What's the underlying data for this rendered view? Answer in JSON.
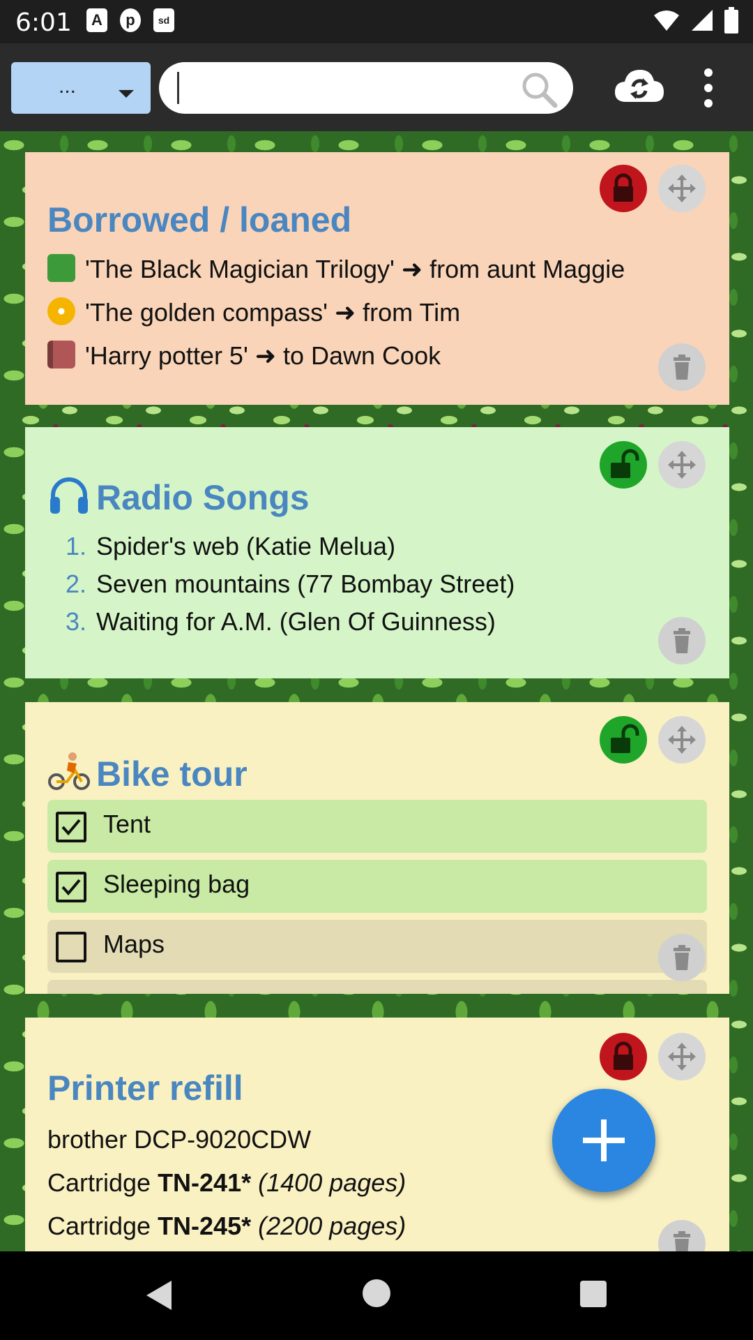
{
  "status_bar": {
    "time": "6:01",
    "left_icons": [
      "A",
      "p",
      "sd"
    ]
  },
  "toolbar": {
    "dropdown_label": "...",
    "search_value": "",
    "search_placeholder": ""
  },
  "notes": [
    {
      "title": "Borrowed / loaned",
      "locked": true,
      "lines": [
        {
          "emoji": "green-book-icon",
          "text": "'The Black Magician Trilogy' ➜ from aunt Maggie"
        },
        {
          "emoji": "dvd-icon",
          "text": "'The golden compass' ➜ from Tim"
        },
        {
          "emoji": "notebook-icon",
          "text": "'Harry potter 5' ➜ to Dawn Cook"
        }
      ]
    },
    {
      "title": "Radio Songs",
      "title_icon": "headphones-icon",
      "locked": false,
      "items": [
        {
          "num": "1.",
          "text": "Spider's web (Katie Melua)"
        },
        {
          "num": "2.",
          "text": "Seven mountains (77 Bombay Street)"
        },
        {
          "num": "3.",
          "text": "Waiting for A.M. (Glen Of Guinness)"
        }
      ]
    },
    {
      "title": "Bike tour",
      "title_icon": "cyclist-icon",
      "locked": false,
      "checklist": [
        {
          "label": "Tent",
          "checked": true
        },
        {
          "label": "Sleeping bag",
          "checked": true
        },
        {
          "label": "Maps",
          "checked": false
        }
      ]
    },
    {
      "title": "Printer refill",
      "locked": true,
      "lines": [
        {
          "plain": "brother DCP-9020CDW"
        },
        {
          "prefix": "Cartridge ",
          "bold": "TN-241*",
          "italic": "(1400 pages)"
        },
        {
          "prefix": "Cartridge ",
          "bold": "TN-245*",
          "italic": "(2200 pages)"
        }
      ]
    }
  ],
  "colors": {
    "title_blue": "#4a86c0",
    "locked_red": "#c0151c",
    "unlocked_green": "#1fa529",
    "fab_blue": "#2a86e0"
  }
}
